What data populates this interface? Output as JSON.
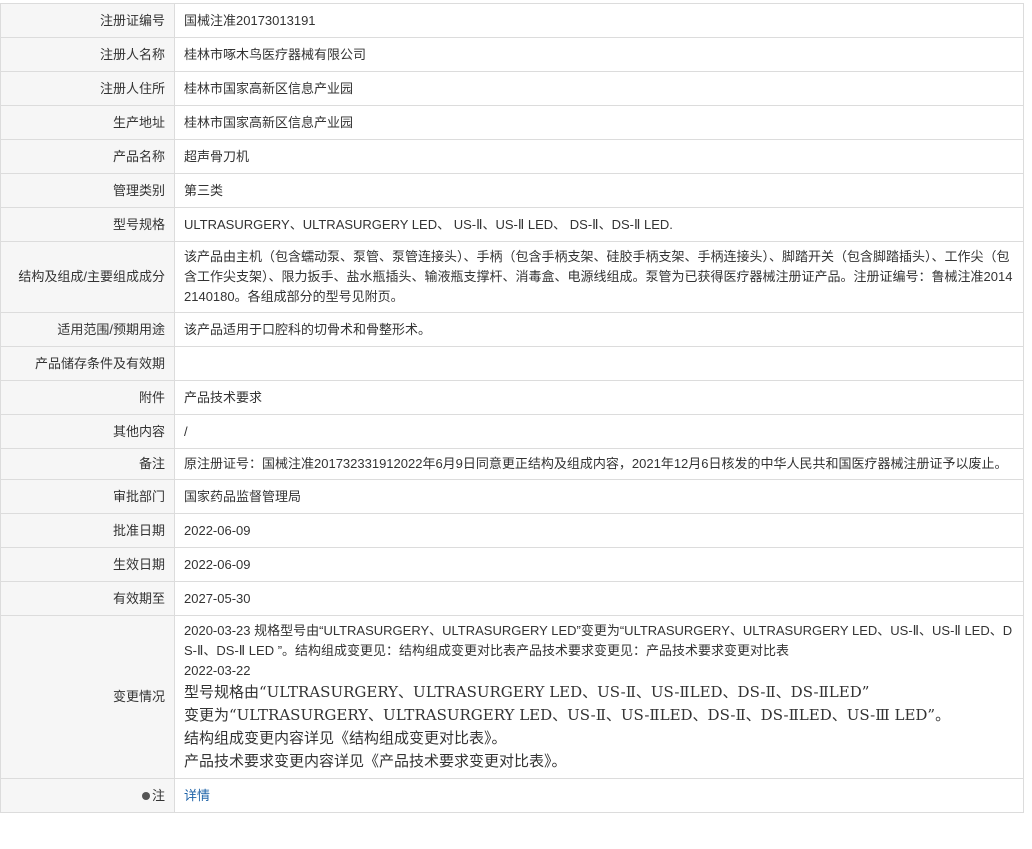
{
  "rows": [
    {
      "label": "注册证编号",
      "value": "国械注准20173013191"
    },
    {
      "label": "注册人名称",
      "value": "桂林市啄木鸟医疗器械有限公司"
    },
    {
      "label": "注册人住所",
      "value": "桂林市国家高新区信息产业园"
    },
    {
      "label": "生产地址",
      "value": "桂林市国家高新区信息产业园"
    },
    {
      "label": "产品名称",
      "value": "超声骨刀机"
    },
    {
      "label": "管理类别",
      "value": "第三类"
    },
    {
      "label": "型号规格",
      "value": "ULTRASURGERY、ULTRASURGERY LED、 US-Ⅱ、US-Ⅱ LED、 DS-Ⅱ、DS-Ⅱ LED."
    },
    {
      "label": "结构及组成/主要组成成分",
      "value": "该产品由主机（包含蠕动泵、泵管、泵管连接头）、手柄（包含手柄支架、硅胶手柄支架、手柄连接头）、脚踏开关（包含脚踏插头）、工作尖（包含工作尖支架）、限力扳手、盐水瓶插头、输液瓶支撑杆、消毒盒、电源线组成。泵管为已获得医疗器械注册证产品。注册证编号：鲁械注准20142140180。各组成部分的型号见附页。"
    },
    {
      "label": "适用范围/预期用途",
      "value": "该产品适用于口腔科的切骨术和骨整形术。"
    },
    {
      "label": "产品储存条件及有效期",
      "value": ""
    },
    {
      "label": "附件",
      "value": "产品技术要求"
    },
    {
      "label": "其他内容",
      "value": "/"
    },
    {
      "label": "备注",
      "value": "原注册证号：国械注准201732331912022年6月9日同意更正结构及组成内容，2021年12月6日核发的中华人民共和国医疗器械注册证予以废止。"
    },
    {
      "label": "审批部门",
      "value": "国家药品监督管理局"
    },
    {
      "label": "批准日期",
      "value": "2022-06-09"
    },
    {
      "label": "生效日期",
      "value": "2022-06-09"
    },
    {
      "label": "有效期至",
      "value": "2027-05-30"
    }
  ],
  "changes": {
    "label": "变更情况",
    "entry1": "2020-03-23 规格型号由“ULTRASURGERY、ULTRASURGERY LED”变更为“ULTRASURGERY、ULTRASURGERY LED、US-Ⅱ、US-Ⅱ LED、DS-Ⅱ、DS-Ⅱ LED ”。结构组成变更见：结构组成变更对比表产品技术要求变更见：产品技术要求变更对比表",
    "entry2_date": "2022-03-22",
    "entry2_line1": "型号规格由“ULTRASURGERY、ULTRASURGERY LED、US-Ⅱ、US-ⅡLED、DS-Ⅱ、DS-ⅡLED”",
    "entry2_line2": "变更为“ULTRASURGERY、ULTRASURGERY LED、US-Ⅱ、US-ⅡLED、DS-Ⅱ、DS-ⅡLED、US-Ⅲ LED”。",
    "entry2_line3": "结构组成变更内容详见《结构组成变更对比表》。",
    "entry2_line4": "产品技术要求变更内容详见《产品技术要求变更对比表》。"
  },
  "note_row": {
    "label": "注",
    "link": "详情"
  }
}
